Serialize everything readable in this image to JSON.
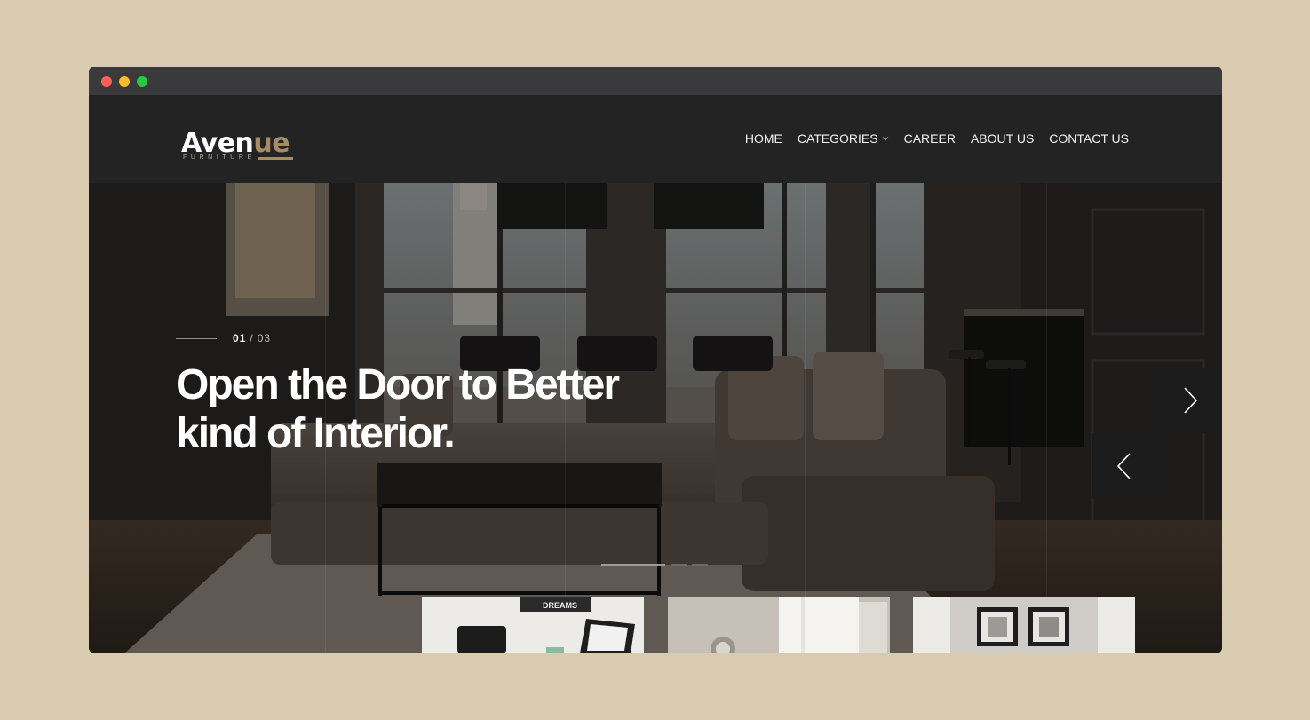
{
  "brand": {
    "name_main": "Aven",
    "name_accent": "ue",
    "tagline": "FURNITURE",
    "accent_color": "#a58b66"
  },
  "nav": {
    "items": [
      {
        "label": "HOME"
      },
      {
        "label": "CATEGORIES",
        "has_dropdown": true
      },
      {
        "label": "CAREER"
      },
      {
        "label": "ABOUT US"
      },
      {
        "label": "CONTACT US"
      }
    ]
  },
  "hero": {
    "current_slide": "01",
    "separator": "/",
    "total_slides": "03",
    "title_line1": "Open the Door to Better",
    "title_line2": "kind of Interior.",
    "next_icon": "chevron-right-icon",
    "prev_icon": "chevron-left-icon"
  },
  "thumbnails": [
    {
      "subject": "office desk with chairs"
    },
    {
      "subject": "room with sunburst mirror"
    },
    {
      "subject": "wall with framed photos"
    }
  ],
  "thumb_sign_text": "DREAMS",
  "colors": {
    "page_background": "#d8cbb0",
    "header_background": "#232323",
    "text": "#ffffff"
  }
}
